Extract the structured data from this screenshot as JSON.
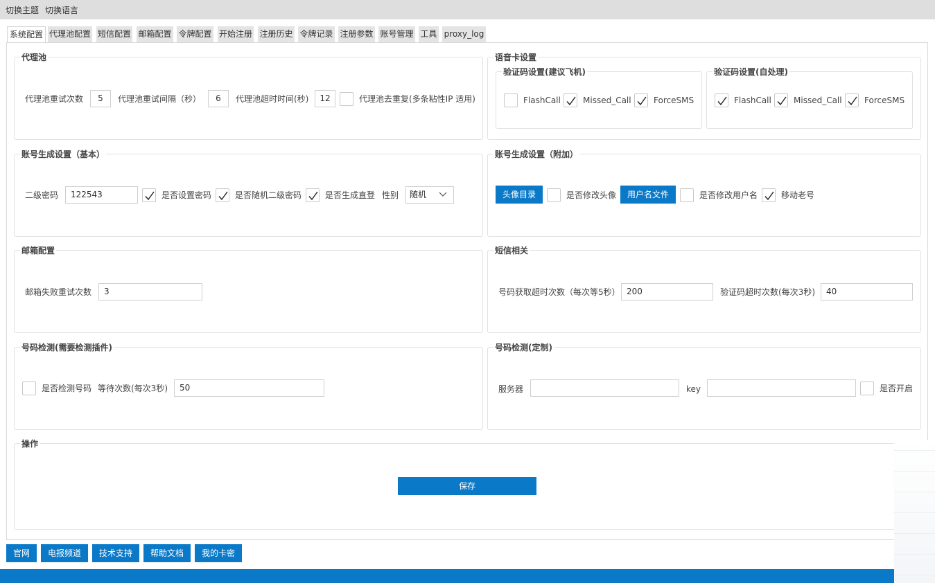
{
  "topbar": {
    "theme": "切换主题",
    "language": "切换语言"
  },
  "tabs": [
    "系统配置",
    "代理池配置",
    "短信配置",
    "邮箱配置",
    "令牌配置",
    "开始注册",
    "注册历史",
    "令牌记录",
    "注册参数",
    "账号管理",
    "工具",
    "proxy_log"
  ],
  "proxy_pool": {
    "title": "代理池",
    "retry_label": "代理池重试次数",
    "retry_value": "5",
    "interval_label": "代理池重试间隔（秒）",
    "interval_value": "6",
    "timeout_label": "代理池超时时间(秒)",
    "timeout_value": "12",
    "dedupe_label": "代理池去重复(多条粘性IP 适用)",
    "dedupe_checked": false
  },
  "voice_card": {
    "title": "语音卡设置",
    "suggested": {
      "title": "验证码设置(建议飞机)",
      "flashcall": "FlashCall",
      "missed_call": "Missed_Call",
      "forcesms": "ForceSMS",
      "flashcall_checked": false,
      "missed_call_checked": true,
      "forcesms_checked": true
    },
    "self": {
      "title": "验证码设置(自处理)",
      "flashcall": "FlashCall",
      "missed_call": "Missed_Call",
      "forcesms": "ForceSMS",
      "flashcall_checked": true,
      "missed_call_checked": true,
      "forcesms_checked": true
    }
  },
  "account_basic": {
    "title": "账号生成设置（基本）",
    "secondary_password_label": "二级密码",
    "secondary_password_value": "122543",
    "set_password_label": "是否设置密码",
    "set_password_checked": true,
    "random_secondary_label": "是否随机二级密码",
    "random_secondary_checked": true,
    "direct_login_label": "是否生成直登",
    "direct_login_checked": true,
    "gender_label": "性别",
    "gender_value": "随机"
  },
  "account_extra": {
    "title": "账号生成设置（附加）",
    "avatar_dir_button": "头像目录",
    "modify_avatar_label": "是否修改头像",
    "modify_avatar_checked": false,
    "username_file_button": "用户名文件",
    "modify_username_label": "是否修改用户名",
    "modify_username_checked": false,
    "mobile_old_label": "移动老号",
    "mobile_old_checked": true
  },
  "email": {
    "title": "邮箱配置",
    "retry_label": "邮箱失败重试次数",
    "retry_value": "3"
  },
  "sms": {
    "title": "短信相关",
    "fetch_timeout_label": "号码获取超时次数（每次等5秒）",
    "fetch_timeout_value": "200",
    "code_timeout_label": "验证码超时次数(每次3秒)",
    "code_timeout_value": "40"
  },
  "number_check": {
    "title": "号码检测(需要检测插件)",
    "check_label": "是否检测号码",
    "check_checked": false,
    "wait_label": "等待次数(每次3秒)",
    "wait_value": "50"
  },
  "number_check_custom": {
    "title": "号码检测(定制)",
    "server_label": "服务器",
    "server_value": "",
    "key_label": "key",
    "key_value": "",
    "enable_label": "是否开启",
    "enable_checked": false
  },
  "operation": {
    "title": "操作",
    "save_button": "保存"
  },
  "footer_buttons": [
    "官网",
    "电报频道",
    "技术支持",
    "帮助文档",
    "我的卡密"
  ],
  "colors": {
    "accent": "#0a79c8",
    "topbar": "#dedede",
    "tab_bg": "#e4e4e4"
  },
  "icons": {
    "checkbox_mark": "check-icon",
    "dropdown": "chevron-down-icon"
  }
}
